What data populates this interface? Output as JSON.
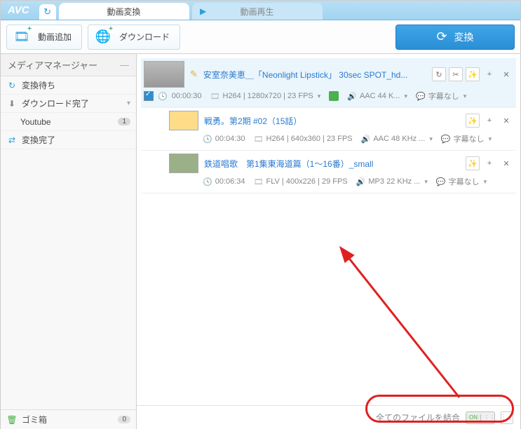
{
  "logo": "AVC",
  "tabs": {
    "convert": "動画変換",
    "play": "動画再生"
  },
  "toolbar": {
    "add": "動画追加",
    "download": "ダウンロード",
    "convert": "変換"
  },
  "sidebar": {
    "header": "メディアマネージャー",
    "waiting": "変換待ち",
    "download_done": "ダウンロード完了",
    "youtube": "Youtube",
    "youtube_count": "1",
    "convert_done": "変換完了",
    "trash": "ゴミ箱",
    "trash_count": "0"
  },
  "items": [
    {
      "title": "安室奈美恵＿「Neonlight Lipstick」 30sec SPOT_hd...",
      "duration": "00:00:30",
      "video": "H264 | 1280x720 | 23 FPS",
      "audio": "AAC 44 K...",
      "sub": "字幕なし"
    },
    {
      "title": "戦勇。第2期 #02（15話）",
      "duration": "00:04:30",
      "video": "H264 | 640x360 | 23 FPS",
      "audio": "AAC 48 KHz ...",
      "sub": "字幕なし"
    },
    {
      "title": "鉄道唱歌　第1集東海道篇（1〜16番）_small",
      "duration": "00:06:34",
      "video": "FLV | 400x226 | 29 FPS",
      "audio": "MP3 22 KHz ...",
      "sub": "字幕なし"
    }
  ],
  "bottom": {
    "merge_label": "全てのファイルを結合",
    "on": "ON"
  }
}
